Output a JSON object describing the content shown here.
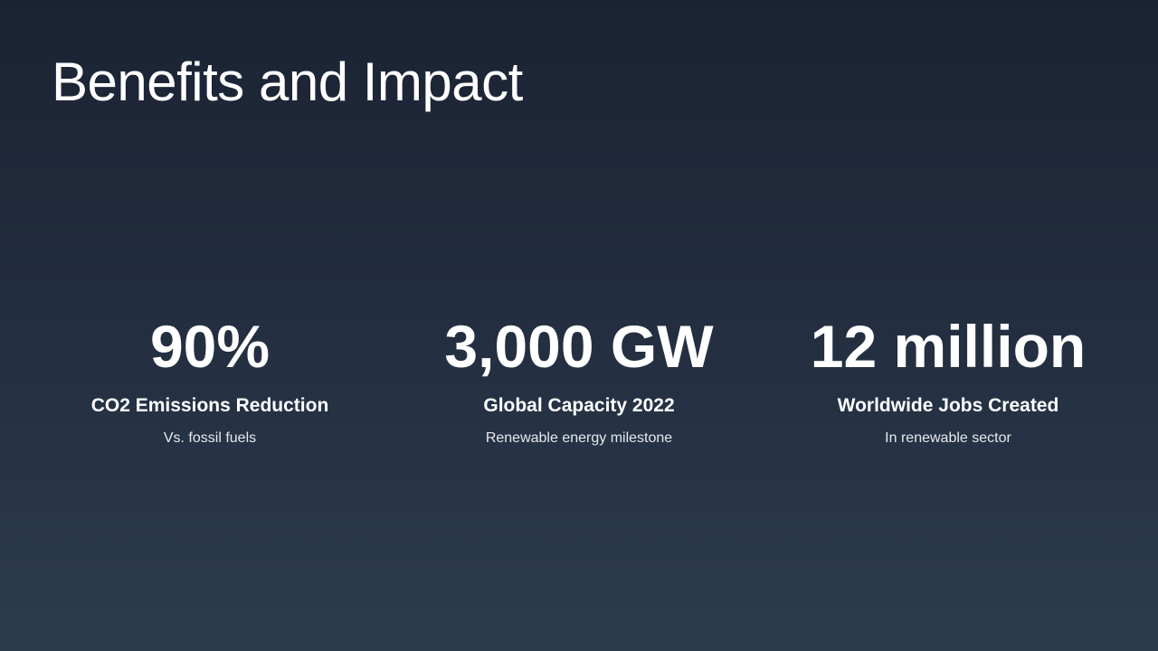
{
  "title": "Benefits and Impact",
  "stats": [
    {
      "value": "90%",
      "label": "CO2 Emissions Reduction",
      "sub": "Vs. fossil fuels"
    },
    {
      "value": "3,000 GW",
      "label": "Global Capacity 2022",
      "sub": "Renewable energy milestone"
    },
    {
      "value": "12 million",
      "label": "Worldwide Jobs Created",
      "sub": "In renewable sector"
    }
  ]
}
